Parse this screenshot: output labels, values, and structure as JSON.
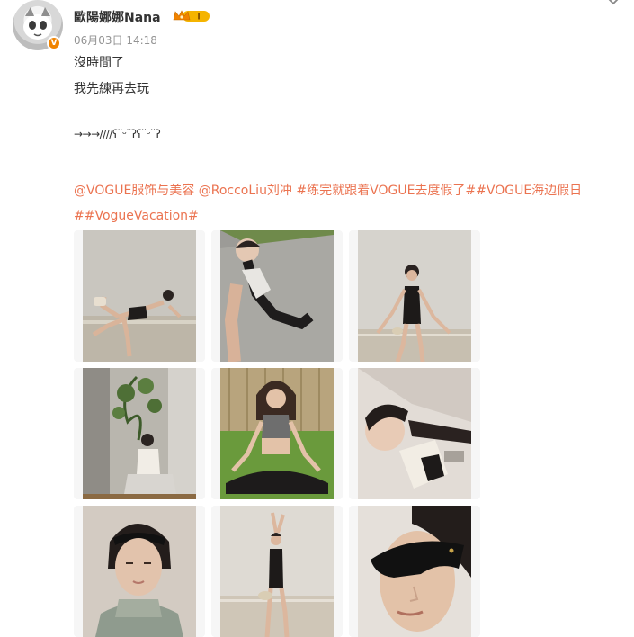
{
  "post": {
    "author": {
      "name": "歐陽娜娜Nana",
      "verified_badge": "V",
      "level_badge": "I"
    },
    "timestamp": "06月03日 14:18",
    "text_lines": [
      "沒時間了",
      "我先練再去玩"
    ],
    "decor_line": "→→→////ʕ˘ᵕ˘ʔʕ˘ᵕ˘ʔ",
    "tags": {
      "mention_1": "@VOGUE服饰与美容",
      "mention_2": "@RoccoLiu刘冲",
      "tag_1": "#练完就跟着VOGUE去度假了#",
      "tag_2": "#VOGUE海边假日#",
      "tag_3": "#VogueVacation#"
    },
    "images": [
      {
        "name": "photo-1",
        "desc": "yoga balance pose by water"
      },
      {
        "name": "photo-2",
        "desc": "sitting on slope selfie"
      },
      {
        "name": "photo-3",
        "desc": "standing pose in black bodysuit"
      },
      {
        "name": "photo-4",
        "desc": "sitting by plant indoors"
      },
      {
        "name": "photo-5",
        "desc": "meditation pose on grass"
      },
      {
        "name": "photo-6",
        "desc": "close-up lying selfie"
      },
      {
        "name": "photo-7",
        "desc": "portrait with sunglasses on head"
      },
      {
        "name": "photo-8",
        "desc": "arms raised pose"
      },
      {
        "name": "photo-9",
        "desc": "portrait in black sunglasses"
      }
    ]
  },
  "colors": {
    "accent": "#eb7350",
    "muted": "#939393",
    "text": "#333333",
    "verified": "#f08300",
    "crown": "#f5b400"
  },
  "icons": [
    "more-chevron-icon",
    "crown-level-icon",
    "verified-v-icon"
  ]
}
